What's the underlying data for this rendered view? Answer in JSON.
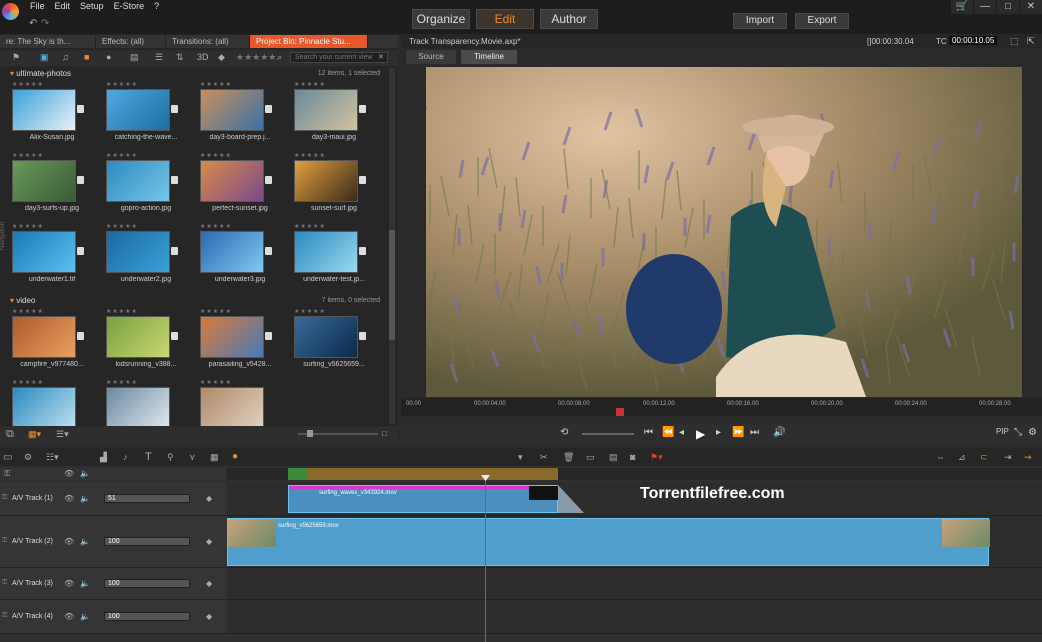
{
  "app": {
    "menu": [
      "File",
      "Edit",
      "Setup",
      "E-Store",
      "?"
    ],
    "modes": [
      "Organize",
      "Edit",
      "Author"
    ],
    "buttons": [
      "Import",
      "Export"
    ]
  },
  "library": {
    "tabs": [
      "re: The Sky is th...",
      "Effects: (all)",
      "Transitions: (all)",
      "Project Bin: Pinnacle Stu..."
    ],
    "search_placeholder": "Search your current view",
    "threed": "3D",
    "section1": {
      "title": "ultimate-photos",
      "info": "12 items, 1 selected",
      "items": [
        "Alix-Susan.jpg",
        "catching-the-wave...",
        "day3-board-prep.j...",
        "day3-maui.jpg",
        "day3-surfs-up.jpg",
        "gopro-action.jpg",
        "perfect-sunset.jpg",
        "sunset-surf.jpg",
        "underwater1.tif",
        "underwater2.jpg",
        "underwater3.jpg",
        "underwater-test.jp..."
      ]
    },
    "section2": {
      "title": "video",
      "info": "7 items, 0 selected",
      "items": [
        "campfire_v977480...",
        "kidsrunning_v388...",
        "parasailing_v5428...",
        "surfing_v5625659..."
      ]
    },
    "navigation": "Navigation"
  },
  "player": {
    "title": "Track Transparency.Movie.axp*",
    "duration": "[]00:00:30.04",
    "tc_label": "TC",
    "timecode": "00:00:10.05",
    "tabs": [
      "Source",
      "Timeline"
    ],
    "ruler": [
      "00.00",
      "00:00:04.00",
      "00:00:08.00",
      "00:00:12.00",
      "00:00:16.00",
      "00:00:20.00",
      "00:00:24.00",
      "00:00:28.00"
    ],
    "pip": "PIP"
  },
  "tracks": [
    {
      "name": "A/V Track (1)",
      "vol": "51"
    },
    {
      "name": "A/V Track (2)",
      "vol": "100"
    },
    {
      "name": "A/V Track (3)",
      "vol": "100"
    },
    {
      "name": "A/V Track (4)",
      "vol": "100"
    }
  ],
  "clips": {
    "c1": "surfing_waves_v343924.mov",
    "c2": "surfing_v5625659.mov"
  },
  "watermark": "Torrentfilefree.com",
  "colors": {
    "accent": "#f08a24",
    "tab_active": "#e8582b",
    "clip": "#4f9ecb",
    "playhead": "#e23b2e"
  }
}
